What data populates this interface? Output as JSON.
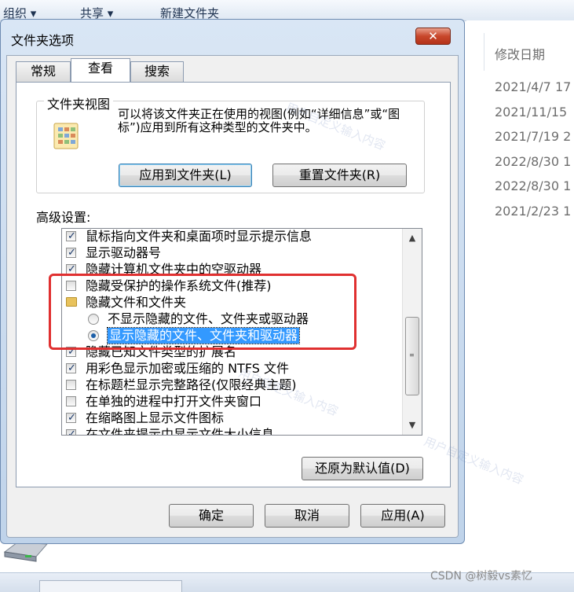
{
  "background": {
    "toolbar": [
      "组织 ▾",
      "共享 ▾",
      "新建文件夹"
    ],
    "column_header": "修改日期",
    "dates": [
      "2021/4/7 17",
      "2021/11/15",
      "2021/7/19 2",
      "2022/8/30 1",
      "2022/8/30 1",
      "2021/2/23 1"
    ],
    "credit": "CSDN @树毅vs素忆"
  },
  "dialog": {
    "title": "文件夹选项",
    "close_symbol": "✕",
    "tabs": [
      {
        "label": "常规",
        "active": false
      },
      {
        "label": "查看",
        "active": true
      },
      {
        "label": "搜索",
        "active": false
      }
    ],
    "folder_views": {
      "group_title": "文件夹视图",
      "description": "可以将该文件夹正在使用的视图(例如“详细信息”或“图标”)应用到所有这种类型的文件夹中。",
      "apply_button": "应用到文件夹(L)",
      "reset_button": "重置文件夹(R)"
    },
    "advanced_label": "高级设置:",
    "settings": [
      {
        "type": "checkbox",
        "checked": true,
        "label": "鼠标指向文件夹和桌面项时显示提示信息"
      },
      {
        "type": "checkbox",
        "checked": true,
        "label": "显示驱动器号"
      },
      {
        "type": "checkbox",
        "checked": true,
        "label": "隐藏计算机文件夹中的空驱动器"
      },
      {
        "type": "checkbox",
        "checked": false,
        "label": "隐藏受保护的操作系统文件(推荐)"
      },
      {
        "type": "folder",
        "label": "隐藏文件和文件夹"
      },
      {
        "type": "radio",
        "checked": false,
        "label": "不显示隐藏的文件、文件夹或驱动器"
      },
      {
        "type": "radio",
        "checked": true,
        "label": "显示隐藏的文件、文件夹和驱动器"
      },
      {
        "type": "checkbox",
        "checked": true,
        "label": "隐藏已知文件类型的扩展名"
      },
      {
        "type": "checkbox",
        "checked": true,
        "label": "用彩色显示加密或压缩的 NTFS 文件"
      },
      {
        "type": "checkbox",
        "checked": false,
        "label": "在标题栏显示完整路径(仅限经典主题)"
      },
      {
        "type": "checkbox",
        "checked": false,
        "label": "在单独的进程中打开文件夹窗口"
      },
      {
        "type": "checkbox",
        "checked": true,
        "label": "在缩略图上显示文件图标"
      },
      {
        "type": "checkbox",
        "checked": true,
        "label": "在文件夹提示中显示文件大小信息"
      }
    ],
    "restore_defaults_button": "还原为默认值(D)",
    "ok_button": "确定",
    "cancel_button": "取消",
    "apply_button": "应用(A)",
    "watermark": "用户自定义输入内容"
  }
}
